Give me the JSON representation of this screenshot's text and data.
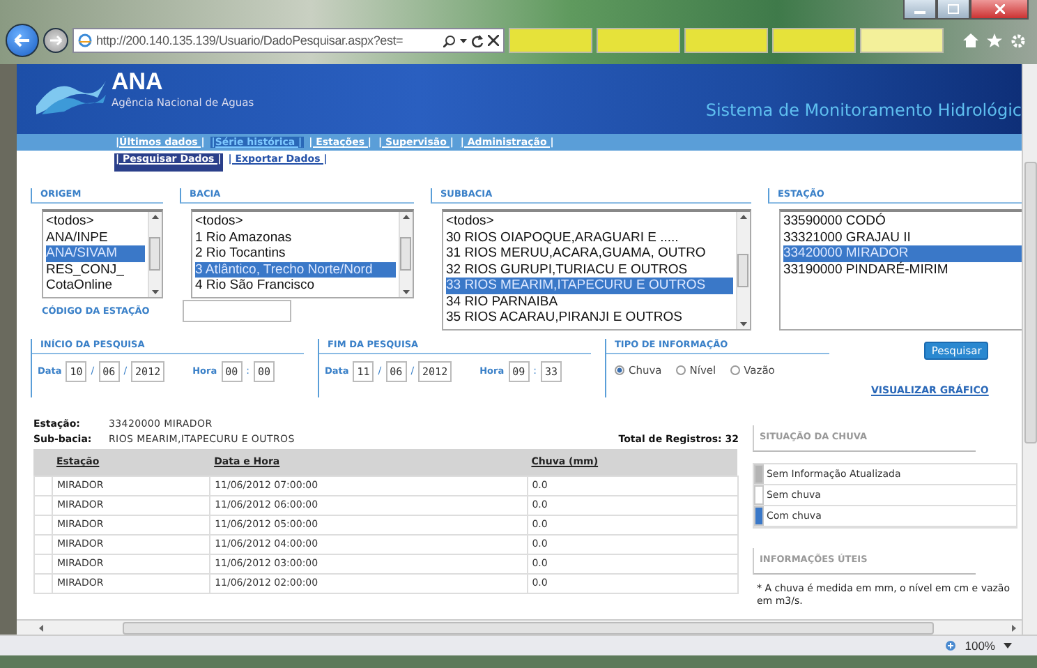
{
  "browser": {
    "url": "http://200.140.135.139/Usuario/DadoPesquisar.aspx?est=",
    "tabs": [
      {
        "selected": false
      },
      {
        "selected": false
      },
      {
        "selected": false
      },
      {
        "selected": false
      },
      {
        "selected": true
      }
    ],
    "zoom": "100%"
  },
  "header": {
    "logo": "ANA",
    "subtitle": "Agência Nacional de Aguas",
    "system_title": "Sistema de Monitoramento Hidrológic"
  },
  "nav": [
    {
      "label": "|Últimos dados |",
      "selected": false
    },
    {
      "label": "|Série histórica |",
      "selected": true
    },
    {
      "label": "| Estações |",
      "selected": false
    },
    {
      "label": "| Supervisão |",
      "selected": false
    },
    {
      "label": "| Administração |",
      "selected": false
    }
  ],
  "subnav": [
    {
      "label": "| Pesquisar Dados |",
      "selected": true
    },
    {
      "label": "| Exportar Dados |",
      "selected": false
    }
  ],
  "filters": {
    "lists": [
      {
        "title": "ORIGEM",
        "options": [
          {
            "label": "<todos>",
            "selected": false
          },
          {
            "label": "ANA/INPE",
            "selected": false
          },
          {
            "label": "ANA/SIVAM",
            "selected": true
          },
          {
            "label": "RES_CONJ_",
            "selected": false
          },
          {
            "label": "CotaOnline",
            "selected": false
          }
        ]
      },
      {
        "title": "BACIA",
        "options": [
          {
            "label": "<todos>",
            "selected": false
          },
          {
            "label": "1 Rio Amazonas",
            "selected": false
          },
          {
            "label": "2 Rio Tocantins",
            "selected": false
          },
          {
            "label": "3 Atlântico, Trecho Norte/Nord",
            "selected": true
          },
          {
            "label": "4 Rio São Francisco",
            "selected": false
          }
        ]
      },
      {
        "title": "SUBBACIA",
        "options": [
          {
            "label": "<todos>",
            "selected": false
          },
          {
            "label": "30 RIOS OIAPOQUE,ARAGUARI E .....",
            "selected": false
          },
          {
            "label": "31 RIOS MERUU,ACARA,GUAMA, OUTRO",
            "selected": false
          },
          {
            "label": "32 RIOS GURUPI,TURIACU E OUTROS",
            "selected": false
          },
          {
            "label": "33 RIOS MEARIM,ITAPECURU E OUTROS",
            "selected": true
          },
          {
            "label": "34 RIO PARNAIBA",
            "selected": false
          },
          {
            "label": "35 RIOS ACARAU,PIRANJI E OUTROS",
            "selected": false
          }
        ]
      },
      {
        "title": "ESTAÇÃO",
        "options": [
          {
            "label": "33590000 CODÓ",
            "selected": false
          },
          {
            "label": "33321000 GRAJAU II",
            "selected": false
          },
          {
            "label": "33420000 MIRADOR",
            "selected": true
          },
          {
            "label": "33190000 PINDARÉ-MIRIM",
            "selected": false
          }
        ]
      }
    ],
    "station_code_label": "CÓDIGO DA ESTAÇÃO",
    "periods": [
      {
        "title": "INÍCIO DA PESQUISA",
        "date_label": "Data",
        "day": "10",
        "month": "06",
        "year": "2012",
        "date_sep": "/",
        "time_label": "Hora",
        "hour": "00",
        "minute": "00",
        "time_sep": ":"
      },
      {
        "title": "FIM DA PESQUISA",
        "date_label": "Data",
        "day": "11",
        "month": "06",
        "year": "2012",
        "date_sep": "/",
        "time_label": "Hora",
        "hour": "09",
        "minute": "33",
        "time_sep": ":"
      }
    ],
    "info_type": {
      "title": "TIPO DE INFORMAÇÃO",
      "options": [
        {
          "label": "Chuva",
          "selected": true
        },
        {
          "label": "Nível",
          "selected": false
        },
        {
          "label": "Vazão",
          "selected": false
        }
      ]
    },
    "search_button": "Pesquisar",
    "chart_link": "VISUALIZAR GRÁFICO"
  },
  "results": {
    "station_label": "Estação:",
    "station": "33420000 MIRADOR",
    "subbasin_label": "Sub-bacia:",
    "subbasin": "RIOS MEARIM,ITAPECURU E OUTROS",
    "total": "Total de Registros: 32",
    "columns": [
      "Estação",
      "Data e Hora",
      "Chuva (mm)"
    ],
    "rows": [
      [
        "MIRADOR",
        "11/06/2012 07:00:00",
        "0.0"
      ],
      [
        "MIRADOR",
        "11/06/2012 06:00:00",
        "0.0"
      ],
      [
        "MIRADOR",
        "11/06/2012 05:00:00",
        "0.0"
      ],
      [
        "MIRADOR",
        "11/06/2012 04:00:00",
        "0.0"
      ],
      [
        "MIRADOR",
        "11/06/2012 03:00:00",
        "0.0"
      ],
      [
        "MIRADOR",
        "11/06/2012 02:00:00",
        "0.0"
      ]
    ]
  },
  "side": {
    "legend_title": "SITUAÇÃO DA CHUVA",
    "legend": [
      {
        "label": "Sem Informação Atualizada",
        "color": "#b4b4b4"
      },
      {
        "label": "Sem chuva",
        "color": "#ffffff"
      },
      {
        "label": "Com chuva",
        "color": "#3a78c8"
      }
    ],
    "info_title": "INFORMAÇÕES ÚTEIS",
    "info_text": "* A chuva é medida em mm, o nível em cm e vazão em m3/s."
  }
}
